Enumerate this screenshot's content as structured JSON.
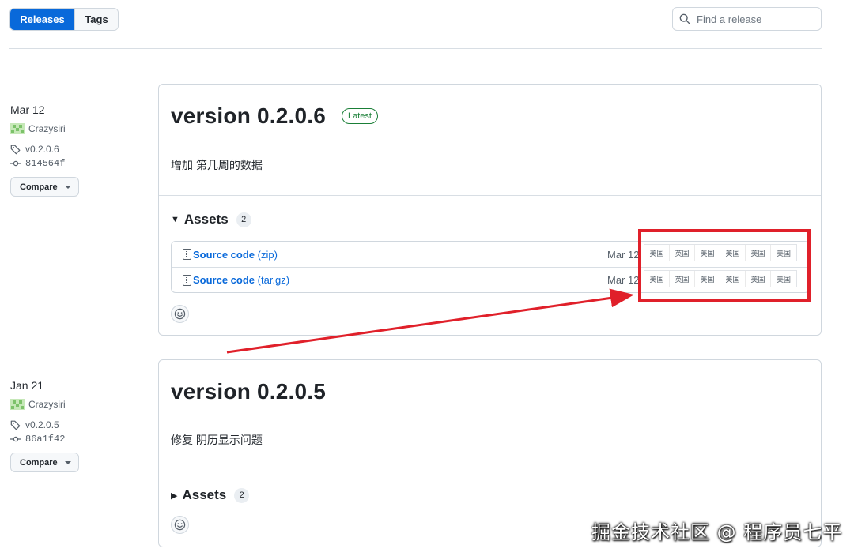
{
  "tabs": {
    "releases": "Releases",
    "tags": "Tags"
  },
  "search": {
    "placeholder": "Find a release"
  },
  "releases": [
    {
      "date": "Mar 12",
      "author": "Crazysiri",
      "tag": "v0.2.0.6",
      "commit": "814564f",
      "compare_label": "Compare",
      "title": "version 0.2.0.6",
      "latest_badge": "Latest",
      "notes": "增加 第几周的数据",
      "assets_label": "Assets",
      "assets_count": "2",
      "assets_expanded": true,
      "assets": [
        {
          "name_bold": "Source code",
          "name_ext": "(zip)",
          "date": "Mar 12",
          "flags": [
            "美国",
            "英国",
            "美国",
            "美国",
            "美国",
            "美国"
          ]
        },
        {
          "name_bold": "Source code",
          "name_ext": "(tar.gz)",
          "date": "Mar 12",
          "flags": [
            "美国",
            "英国",
            "美国",
            "美国",
            "美国",
            "美国"
          ]
        }
      ]
    },
    {
      "date": "Jan 21",
      "author": "Crazysiri",
      "tag": "v0.2.0.5",
      "commit": "86a1f42",
      "compare_label": "Compare",
      "title": "version 0.2.0.5",
      "notes": "修复 阴历显示问题",
      "assets_label": "Assets",
      "assets_count": "2",
      "assets_expanded": false
    }
  ],
  "annotation": {
    "color": "#e0202a"
  },
  "watermark": "掘金技术社区 @ 程序员七平",
  "colors": {
    "accent": "#0969da",
    "latest": "#1a7f37",
    "border": "#d0d7de"
  }
}
